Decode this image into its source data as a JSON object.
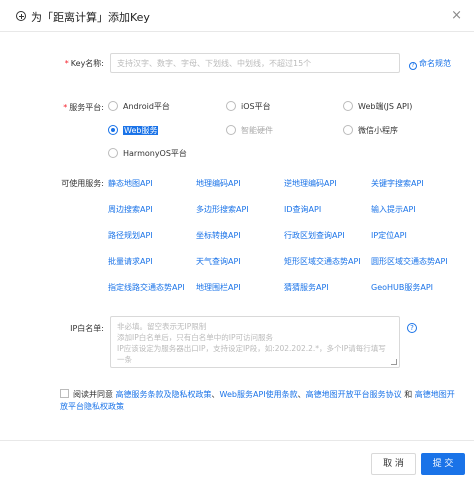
{
  "header": {
    "title": "为「距离计算」添加Key",
    "close": "×"
  },
  "key_name": {
    "label": "Key名称:",
    "placeholder": "支持汉字、数字、字母、下划线、中划线，不超过15个",
    "help": "命名规范"
  },
  "platform": {
    "label": "服务平台:",
    "options": [
      {
        "label": "Android平台",
        "state": "unchecked"
      },
      {
        "label": "iOS平台",
        "state": "unchecked"
      },
      {
        "label": "Web端(JS API)",
        "state": "unchecked"
      },
      {
        "label": "Web服务",
        "state": "checked"
      },
      {
        "label": "智能硬件",
        "state": "disabled"
      },
      {
        "label": "微信小程序",
        "state": "unchecked"
      },
      {
        "label": "HarmonyOS平台",
        "state": "unchecked"
      }
    ]
  },
  "services": {
    "label": "可使用服务:",
    "items": [
      "静态地图API",
      "地理编码API",
      "逆地理编码API",
      "关键字搜索API",
      "周边搜索API",
      "多边形搜索API",
      "ID查询API",
      "输入提示API",
      "路径规划API",
      "坐标转换API",
      "行政区划查询API",
      "IP定位API",
      "批量请求API",
      "天气查询API",
      "矩形区域交通态势API",
      "圆形区域交通态势API",
      "指定线路交通态势API",
      "地理围栏API",
      "猜猜服务API",
      "GeoHUB服务API"
    ]
  },
  "ip_whitelist": {
    "label": "IP白名单:",
    "placeholder_lines": [
      "非必填。留空表示无IP限制",
      "添加IP白名单后，只有白名单中的IP可访问服务",
      "IP应该设定为服务器出口IP，支持设定IP段，如:202.202.2.*，多个IP请每行填写一条"
    ]
  },
  "agreement": {
    "prefix": "阅读并同意",
    "link1": "高德服务条款及隐私权政策",
    "sep1": "、",
    "link2": "Web服务API使用条款",
    "sep2": "、",
    "link3": "高德地图开放平台服务协议",
    "sep3": "和",
    "link4": "高德地图开放平台隐私权政策"
  },
  "footer": {
    "cancel": "取 消",
    "ok": "提 交"
  }
}
